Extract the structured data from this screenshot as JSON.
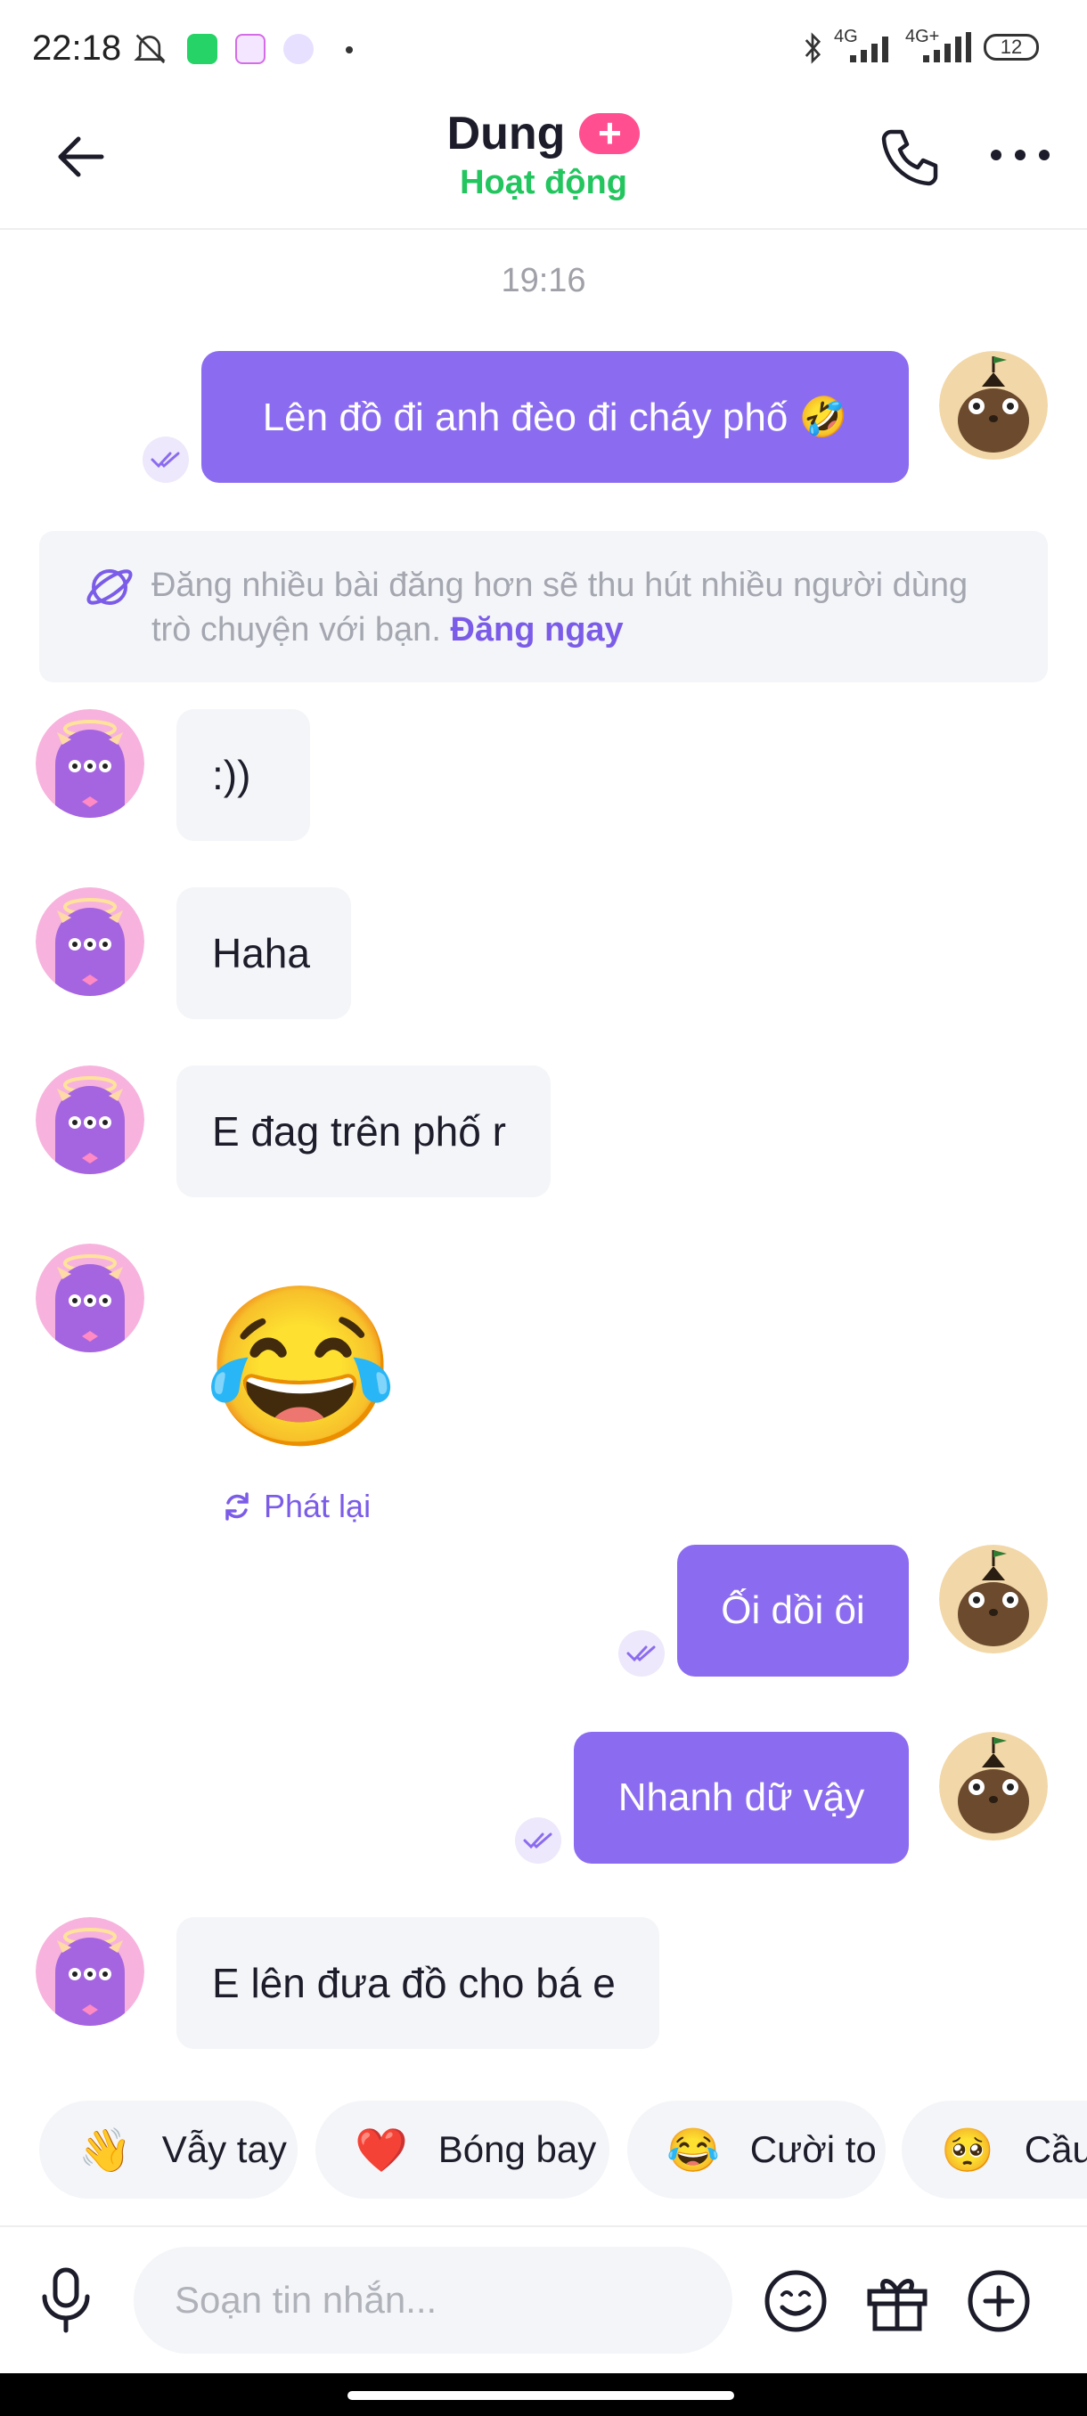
{
  "status_bar": {
    "time": "22:18",
    "network1": "4G",
    "network2": "4G+",
    "battery": "12",
    "icons": [
      "mute-bell-icon",
      "whatsapp-icon",
      "badoo-icon",
      "messenger-icon",
      "bluetooth-icon",
      "signal-icon"
    ]
  },
  "header": {
    "back_icon": "arrow-left-icon",
    "name": "Dung",
    "badge": "+",
    "status": "Hoạt động",
    "call_icon": "phone-icon",
    "more_icon": "more-icon"
  },
  "timestamp": "19:16",
  "notice": {
    "icon": "planet-icon",
    "text": "Đăng nhiều bài đăng hơn sẽ thu hút nhiều người dùng trò chuyện với bạn.",
    "link": "Đăng ngay"
  },
  "messages": [
    {
      "side": "out",
      "text": "Lên đồ đi anh đèo đi cháy phố 🤣"
    },
    {
      "side": "in",
      "text": ":))"
    },
    {
      "side": "in",
      "text": "Haha"
    },
    {
      "side": "in",
      "text": "E đag trên phố r"
    },
    {
      "side": "in",
      "text": "😂"
    },
    {
      "side": "out",
      "text": "Ối dồi ôi"
    },
    {
      "side": "out",
      "text": "Nhanh dữ vậy"
    },
    {
      "side": "in",
      "text": "E lên đưa đồ cho bá e"
    }
  ],
  "replay_label": "Phát lại",
  "quick_reactions": [
    {
      "emoji": "👋",
      "label": "Vẫy tay"
    },
    {
      "emoji": "❤️",
      "label": "Bóng bay"
    },
    {
      "emoji": "😂",
      "label": "Cười to"
    },
    {
      "emoji": "🥺",
      "label": "Cầu x"
    }
  ],
  "composer": {
    "placeholder": "Soạn tin nhắn...",
    "icons": [
      "microphone-icon",
      "emoji-icon",
      "gift-icon",
      "add-icon"
    ]
  },
  "colors": {
    "accent": "#8b6cf0",
    "online": "#22c55e",
    "badge": "#ff4f91",
    "incoming_bubble": "#f4f5f8"
  }
}
